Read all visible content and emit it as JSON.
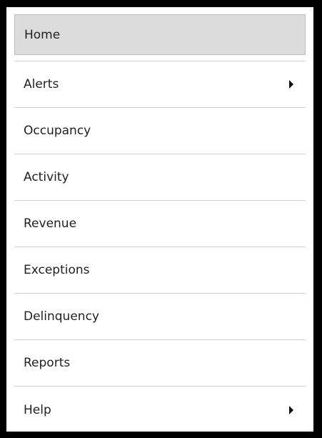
{
  "menu": {
    "items": [
      {
        "label": "Home",
        "active": true,
        "has_submenu": false
      },
      {
        "label": "Alerts",
        "active": false,
        "has_submenu": true,
        "submenu_icon": "caret-right-icon"
      },
      {
        "label": "Occupancy",
        "active": false,
        "has_submenu": false
      },
      {
        "label": "Activity",
        "active": false,
        "has_submenu": false
      },
      {
        "label": "Revenue",
        "active": false,
        "has_submenu": false
      },
      {
        "label": "Exceptions",
        "active": false,
        "has_submenu": false
      },
      {
        "label": "Delinquency",
        "active": false,
        "has_submenu": false
      },
      {
        "label": "Reports",
        "active": false,
        "has_submenu": false
      },
      {
        "label": "Help",
        "active": false,
        "has_submenu": true,
        "submenu_icon": "caret-right-icon"
      }
    ]
  },
  "colors": {
    "background": "#000000",
    "panel": "#ffffff",
    "active_item": "#dcdcdc",
    "divider": "#d0d0d0",
    "text": "#1f1f1f"
  }
}
